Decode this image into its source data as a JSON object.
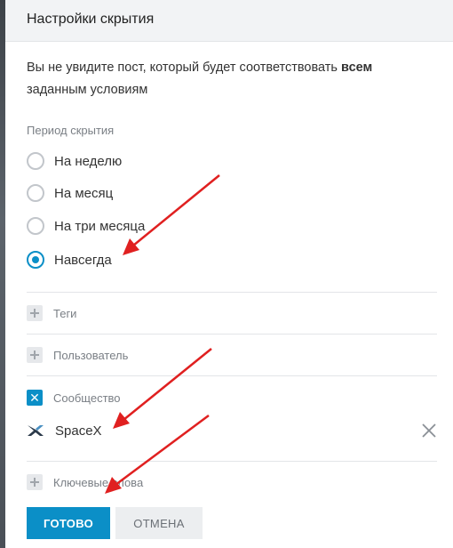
{
  "dialog": {
    "title": "Настройки скрытия",
    "intro_text": "Вы не увидите пост, который будет соответствовать",
    "intro_bold": "всем",
    "intro_rest": "заданным условиям"
  },
  "period": {
    "label": "Период скрытия",
    "options": [
      {
        "label": "На неделю",
        "checked": false
      },
      {
        "label": "На месяц",
        "checked": false
      },
      {
        "label": "На три месяца",
        "checked": false
      },
      {
        "label": "Навсегда",
        "checked": true
      }
    ]
  },
  "filters": {
    "tags_label": "Теги",
    "user_label": "Пользователь",
    "community_label": "Сообщество",
    "community_selected": "SpaceX",
    "keywords_label": "Ключевые слова"
  },
  "buttons": {
    "done": "ГОТОВО",
    "cancel": "ОТМЕНА"
  },
  "colors": {
    "accent": "#0b8fc7",
    "annotation_arrow": "#e02020"
  },
  "icons": {
    "check": "✕",
    "community_logo": "spacex-logo-icon",
    "remove": "close-icon"
  }
}
